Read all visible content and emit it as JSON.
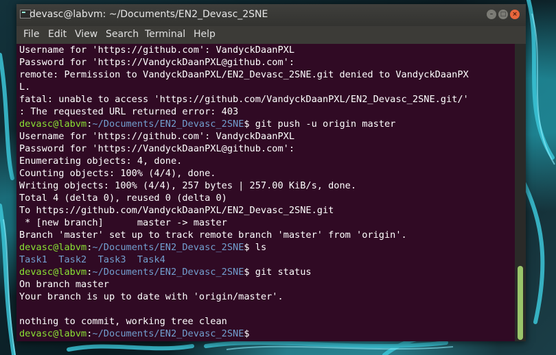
{
  "window": {
    "title": "devasc@labvm: ~/Documents/EN2_Devasc_2SNE"
  },
  "menu": [
    "File",
    "Edit",
    "View",
    "Search",
    "Terminal",
    "Help"
  ],
  "prompt": {
    "user": "devasc@labvm",
    "sep": ":",
    "path": "~/Documents/EN2_Devasc_2SNE",
    "symbol": "$"
  },
  "terminal": {
    "l1": "Username for 'https://github.com': VandyckDaanPXL",
    "l2": "Password for 'https://VandyckDaanPXL@github.com':",
    "l3": "remote: Permission to VandyckDaanPXL/EN2_Devasc_2SNE.git denied to VandyckDaanPX",
    "l4": "L.",
    "l5": "fatal: unable to access 'https://github.com/VandyckDaanPXL/EN2_Devasc_2SNE.git/'",
    "l6": ": The requested URL returned error: 403",
    "cmd1": " git push -u origin master",
    "l8": "Username for 'https://github.com': VandyckDaanPXL",
    "l9": "Password for 'https://VandyckDaanPXL@github.com':",
    "l10": "Enumerating objects: 4, done.",
    "l11": "Counting objects: 100% (4/4), done.",
    "l12": "Writing objects: 100% (4/4), 257 bytes | 257.00 KiB/s, done.",
    "l13": "Total 4 (delta 0), reused 0 (delta 0)",
    "l14": "To https://github.com/VandyckDaanPXL/EN2_Devasc_2SNE.git",
    "l15": " * [new branch]      master -> master",
    "l16": "Branch 'master' set up to track remote branch 'master' from 'origin'.",
    "cmd2": " ls",
    "ls_output": "Task1  Task2  Task3  Task4",
    "cmd3": " git status",
    "l20": "On branch master",
    "l21": "Your branch is up to date with 'origin/master'.",
    "l22": "",
    "l23": "nothing to commit, working tree clean",
    "cmd4": ""
  },
  "colors": {
    "terminal_bg": "#300a24",
    "prompt_user": "#8ae234",
    "prompt_path": "#729fcf",
    "close_button": "#e8663c"
  }
}
